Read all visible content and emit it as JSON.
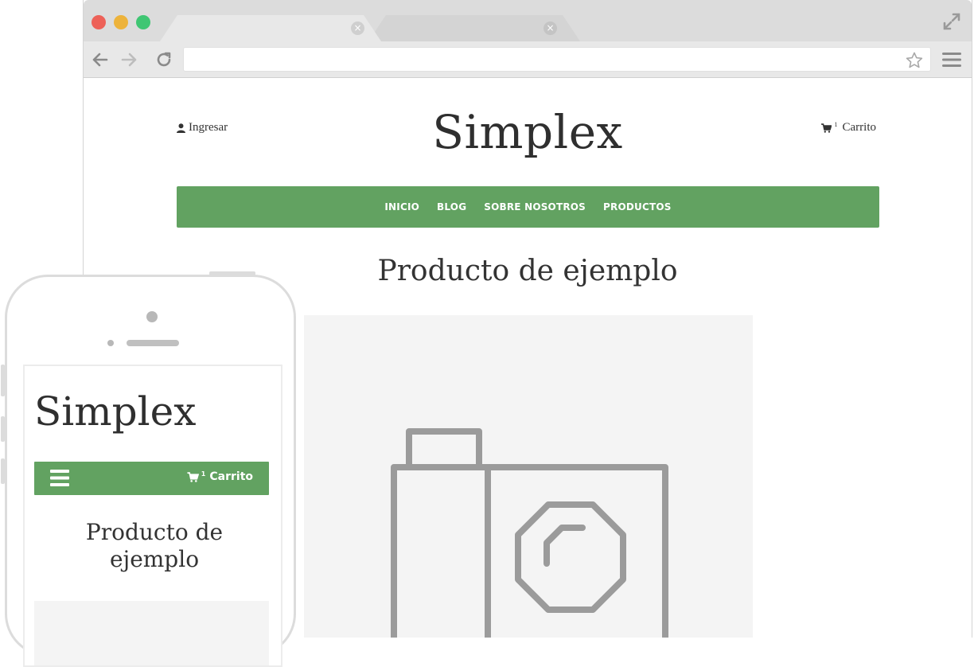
{
  "browser": {
    "url_value": "",
    "icons": {
      "back": "arrow-left-icon",
      "forward": "arrow-right-icon",
      "reload": "reload-icon",
      "bookmark": "star-icon",
      "menu": "hamburger-icon",
      "expand": "expand-icon",
      "tab_close": "close-icon"
    },
    "tab_close_glyph": "×"
  },
  "site": {
    "logo": "Simplex",
    "login_label": "Ingresar",
    "cart_label": "Carrito",
    "cart_count": "1",
    "nav": [
      {
        "label": "INICIO"
      },
      {
        "label": "BLOG"
      },
      {
        "label": "SOBRE NOSOTROS"
      },
      {
        "label": "PRODUCTOS"
      }
    ],
    "product_title": "Producto de ejemplo",
    "accent_color": "#62a261"
  },
  "mobile": {
    "logo": "Simplex",
    "cart_label": "Carrito",
    "cart_count": "1",
    "product_title_line1": "Producto de",
    "product_title_line2": "ejemplo"
  }
}
